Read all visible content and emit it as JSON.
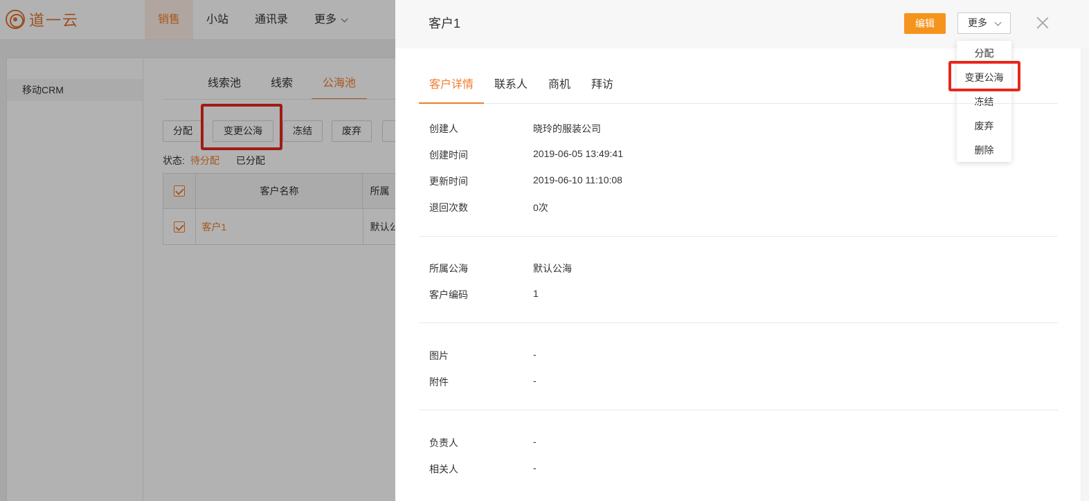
{
  "app": {
    "logo_text": "道一云",
    "nav": [
      "销售",
      "小站",
      "通讯录",
      "更多"
    ]
  },
  "sidebar": {
    "item": "移动CRM"
  },
  "subtabs": [
    "线索池",
    "线索",
    "公海池"
  ],
  "actions": [
    "分配",
    "变更公海",
    "冻结",
    "废弃"
  ],
  "status": {
    "label": "状态:",
    "active": "待分配",
    "other": "已分配"
  },
  "table": {
    "headers": [
      "客户名称",
      "所属"
    ],
    "rows": [
      {
        "name": "客户1",
        "pool": "默认公海"
      }
    ]
  },
  "drawer": {
    "title": "客户1",
    "edit_label": "编辑",
    "more_label": "更多",
    "dropdown": [
      "分配",
      "变更公海",
      "冻结",
      "废弃",
      "删除"
    ],
    "tabs": [
      "客户详情",
      "联系人",
      "商机",
      "拜访"
    ],
    "fields": [
      {
        "label": "创建人",
        "value": "晓玲的服装公司"
      },
      {
        "label": "创建时间",
        "value": "2019-06-05 13:49:41"
      },
      {
        "label": "更新时间",
        "value": "2019-06-10 11:10:08"
      },
      {
        "label": "退回次数",
        "value": "0次"
      },
      {
        "label": "所属公海",
        "value": "默认公海"
      },
      {
        "label": "客户编码",
        "value": "1"
      },
      {
        "label": "图片",
        "value": "-"
      },
      {
        "label": "附件",
        "value": "-"
      },
      {
        "label": "负责人",
        "value": "-"
      },
      {
        "label": "相关人",
        "value": "-"
      }
    ]
  },
  "colors": {
    "accent": "#f07c2b",
    "edit_button": "#f5941d",
    "highlight_box": "#e8261d"
  }
}
